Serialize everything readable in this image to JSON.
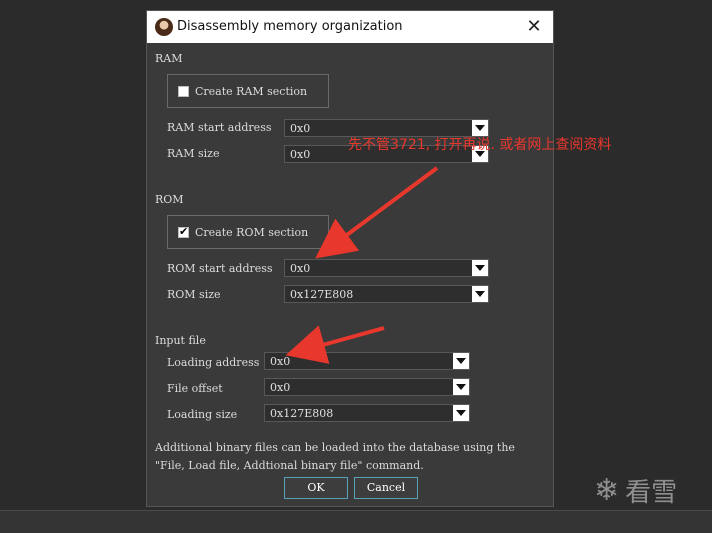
{
  "dialog": {
    "title": "Disassembly memory organization",
    "close_glyph": "✕"
  },
  "ram": {
    "section_label": "RAM",
    "create_label": "Create RAM section",
    "create_checked": false,
    "start_label": "RAM start address",
    "start_value": "0x0",
    "size_label": "RAM size",
    "size_value": "0x0"
  },
  "rom": {
    "section_label": "ROM",
    "create_label": "Create ROM section",
    "create_checked": true,
    "check_glyph": "✔",
    "start_label": "ROM start address",
    "start_value": "0x0",
    "size_label": "ROM size",
    "size_value": "0x127E808"
  },
  "input_file": {
    "section_label": "Input file",
    "loading_address_label": "Loading address",
    "loading_address_value": "0x0",
    "file_offset_label": "File offset",
    "file_offset_value": "0x0",
    "loading_size_label": "Loading size",
    "loading_size_value": "0x127E808"
  },
  "description": {
    "line1": "Additional binary files can be loaded into the database using the",
    "line2": "\"File, Load file, Addtional binary file\" command."
  },
  "buttons": {
    "ok": "OK",
    "cancel": "Cancel"
  },
  "annotation": {
    "text": "先不管3721, 打开再说. 或者网上查阅资料",
    "color": "#e8372c"
  },
  "watermark": {
    "glyph": "❄",
    "text": "看雪"
  },
  "colors": {
    "background": "#2b2b2b",
    "dialog": "#3a3a3a",
    "button_border": "#5aa0b8",
    "annotation_red": "#e8372c"
  },
  "icons": [
    "avatar-icon",
    "close-icon",
    "checkbox-checked-icon",
    "dropdown-arrow-icon",
    "snowflake-logo-icon"
  ]
}
